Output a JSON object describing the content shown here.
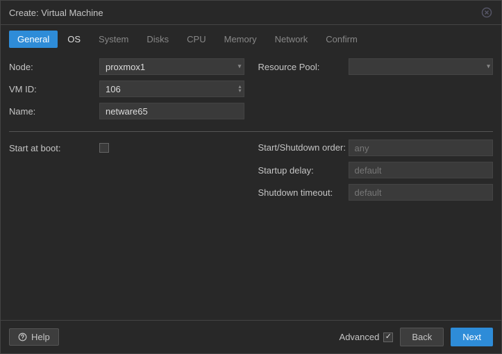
{
  "title": "Create: Virtual Machine",
  "tabs": [
    "General",
    "OS",
    "System",
    "Disks",
    "CPU",
    "Memory",
    "Network",
    "Confirm"
  ],
  "activeTab": 0,
  "form": {
    "node": {
      "label": "Node:",
      "value": "proxmox1"
    },
    "vmid": {
      "label": "VM ID:",
      "value": "106"
    },
    "name": {
      "label": "Name:",
      "value": "netware65"
    },
    "resourcePool": {
      "label": "Resource Pool:",
      "value": ""
    },
    "startAtBoot": {
      "label": "Start at boot:",
      "checked": false
    },
    "startOrder": {
      "label": "Start/Shutdown order:",
      "placeholder": "any",
      "value": ""
    },
    "startupDelay": {
      "label": "Startup delay:",
      "placeholder": "default",
      "value": ""
    },
    "shutdownTimeout": {
      "label": "Shutdown timeout:",
      "placeholder": "default",
      "value": ""
    }
  },
  "footer": {
    "help": "Help",
    "advanced": "Advanced",
    "advancedChecked": true,
    "back": "Back",
    "next": "Next"
  }
}
